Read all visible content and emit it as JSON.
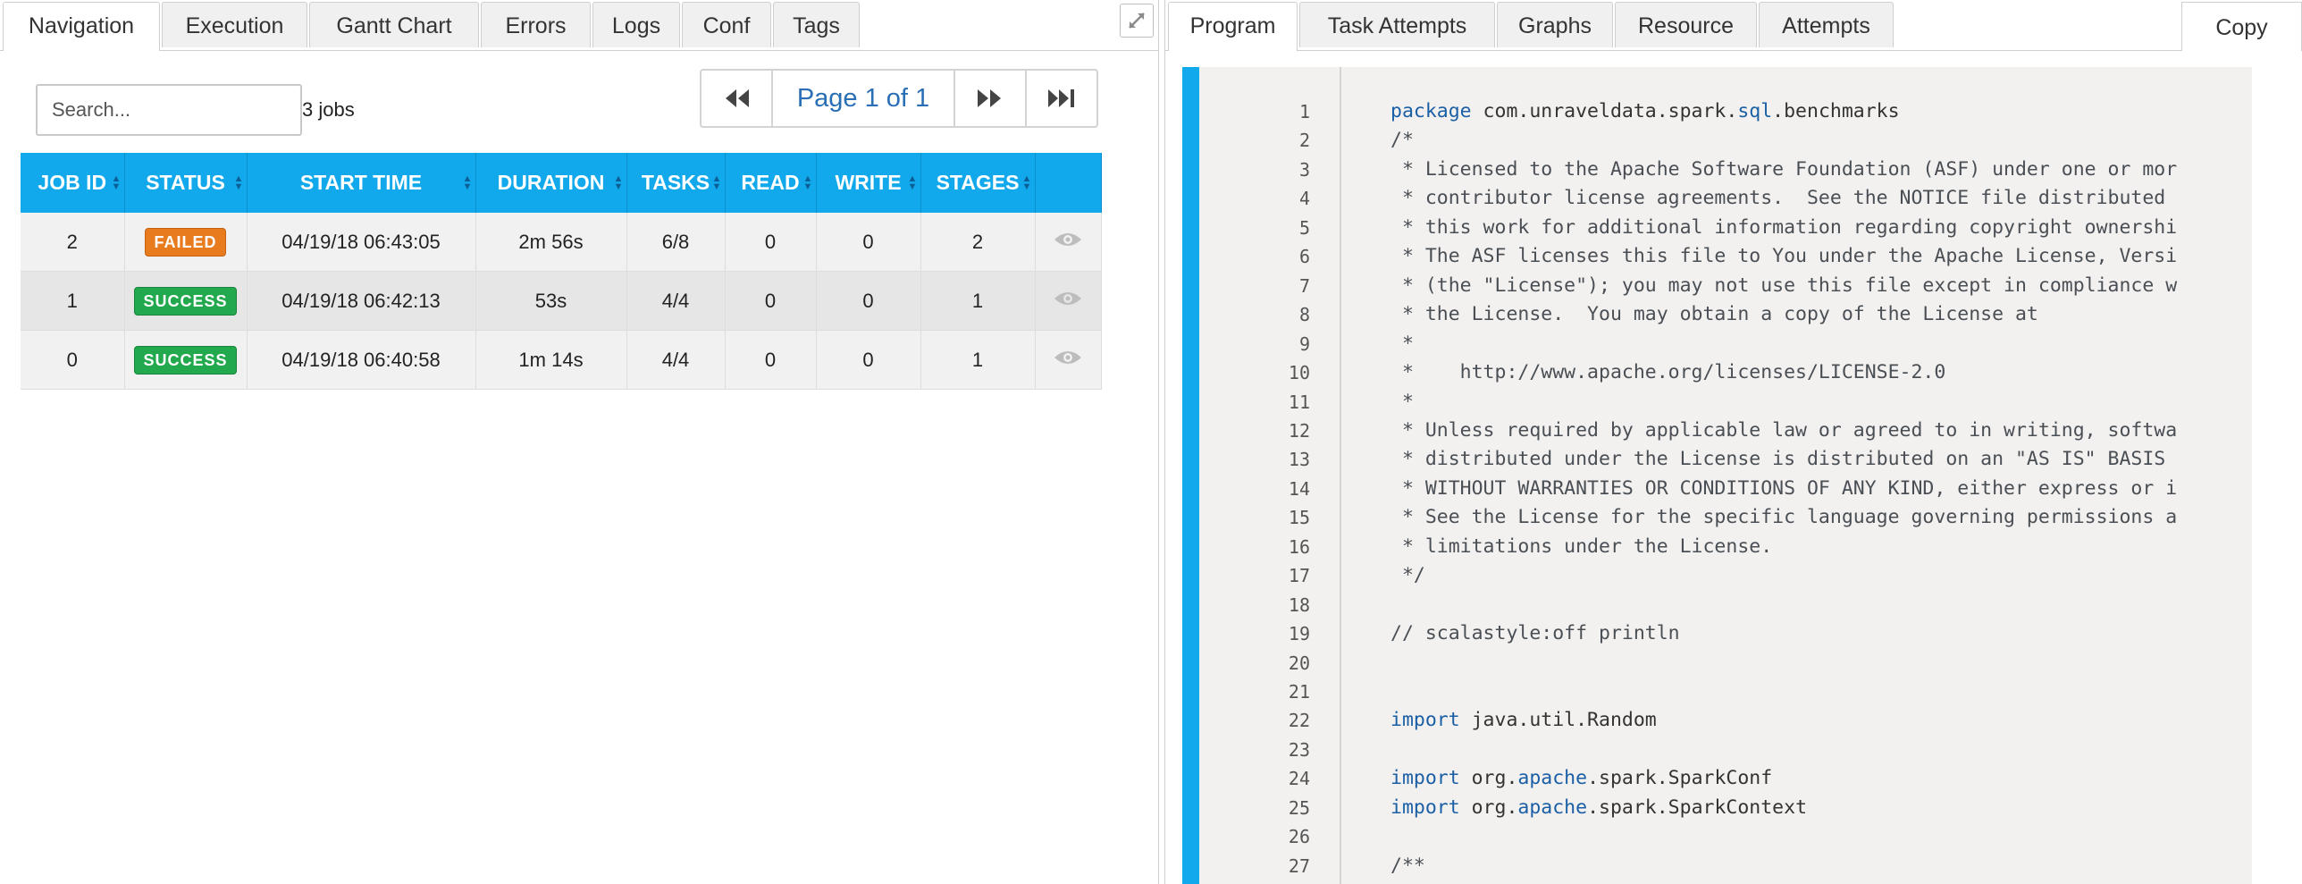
{
  "left_panel": {
    "tabs": [
      "Navigation",
      "Execution",
      "Gantt Chart",
      "Errors",
      "Logs",
      "Conf",
      "Tags"
    ],
    "active_tab": "Navigation",
    "search": {
      "placeholder": "Search...",
      "value": ""
    },
    "job_count": "3 jobs",
    "pagination": {
      "label": "Page 1 of 1",
      "current_page": 1,
      "total_pages": 1
    },
    "table": {
      "columns": [
        "JOB ID",
        "STATUS",
        "START TIME",
        "DURATION",
        "TASKS",
        "READ",
        "WRITE",
        "STAGES"
      ],
      "rows": [
        {
          "job_id": "2",
          "status": "FAILED",
          "start_time": "04/19/18 06:43:05",
          "duration": "2m 56s",
          "tasks": "6/8",
          "read": "0",
          "write": "0",
          "stages": "2"
        },
        {
          "job_id": "1",
          "status": "SUCCESS",
          "start_time": "04/19/18 06:42:13",
          "duration": "53s",
          "tasks": "4/4",
          "read": "0",
          "write": "0",
          "stages": "1"
        },
        {
          "job_id": "0",
          "status": "SUCCESS",
          "start_time": "04/19/18 06:40:58",
          "duration": "1m 14s",
          "tasks": "4/4",
          "read": "0",
          "write": "0",
          "stages": "1"
        }
      ]
    }
  },
  "right_panel": {
    "tabs": [
      "Program",
      "Task Attempts",
      "Graphs",
      "Resource",
      "Attempts"
    ],
    "active_tab": "Program",
    "copy_label": "Copy",
    "code_lines": [
      {
        "n": "1",
        "text": "package com.unraveldata.spark.sql.benchmarks"
      },
      {
        "n": "2",
        "text": "/*"
      },
      {
        "n": "3",
        "text": " * Licensed to the Apache Software Foundation (ASF) under one or mor"
      },
      {
        "n": "4",
        "text": " * contributor license agreements.  See the NOTICE file distributed"
      },
      {
        "n": "5",
        "text": " * this work for additional information regarding copyright ownershi"
      },
      {
        "n": "6",
        "text": " * The ASF licenses this file to You under the Apache License, Versi"
      },
      {
        "n": "7",
        "text": " * (the \"License\"); you may not use this file except in compliance w"
      },
      {
        "n": "8",
        "text": " * the License.  You may obtain a copy of the License at"
      },
      {
        "n": "9",
        "text": " *"
      },
      {
        "n": "10",
        "text": " *    http://www.apache.org/licenses/LICENSE-2.0"
      },
      {
        "n": "11",
        "text": " *"
      },
      {
        "n": "12",
        "text": " * Unless required by applicable law or agreed to in writing, softwa"
      },
      {
        "n": "13",
        "text": " * distributed under the License is distributed on an \"AS IS\" BASIS"
      },
      {
        "n": "14",
        "text": " * WITHOUT WARRANTIES OR CONDITIONS OF ANY KIND, either express or i"
      },
      {
        "n": "15",
        "text": " * See the License for the specific language governing permissions a"
      },
      {
        "n": "16",
        "text": " * limitations under the License."
      },
      {
        "n": "17",
        "text": " */"
      },
      {
        "n": "18",
        "text": ""
      },
      {
        "n": "19",
        "text": "// scalastyle:off println"
      },
      {
        "n": "20",
        "text": ""
      },
      {
        "n": "21",
        "text": ""
      },
      {
        "n": "22",
        "text": "import java.util.Random"
      },
      {
        "n": "23",
        "text": ""
      },
      {
        "n": "24",
        "text": "import org.apache.spark.SparkConf"
      },
      {
        "n": "25",
        "text": "import org.apache.spark.SparkContext"
      },
      {
        "n": "26",
        "text": ""
      },
      {
        "n": "27",
        "text": "/**"
      }
    ]
  },
  "colors": {
    "table_header": "#12a9ec",
    "failed_badge": "#e97b1f",
    "success_badge": "#22a94d",
    "code_accent": "#12a9ec",
    "pager_text": "#2a6fb5"
  }
}
